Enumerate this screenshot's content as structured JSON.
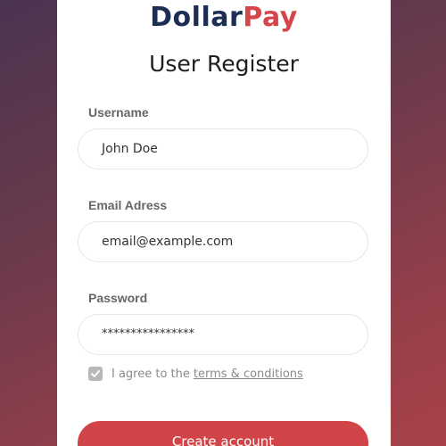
{
  "brand": {
    "part1": "Dollar",
    "part2": "Pay",
    "color_primary": "#1d2e54",
    "color_accent": "#d6454a"
  },
  "title": "User Register",
  "form": {
    "username_label": "Username",
    "username_value": "John Doe",
    "email_label": "Email Adress",
    "email_value": "email@example.com",
    "password_label": "Password",
    "password_value": "****************",
    "terms_checked": true,
    "terms_text": "I agree to the",
    "terms_link": "terms & conditions",
    "submit_label": "Create account"
  },
  "icons": {
    "checkbox": "check-icon"
  },
  "colors": {
    "button": "#d14548",
    "background_start": "#4a3450",
    "background_end": "#a8424a"
  }
}
